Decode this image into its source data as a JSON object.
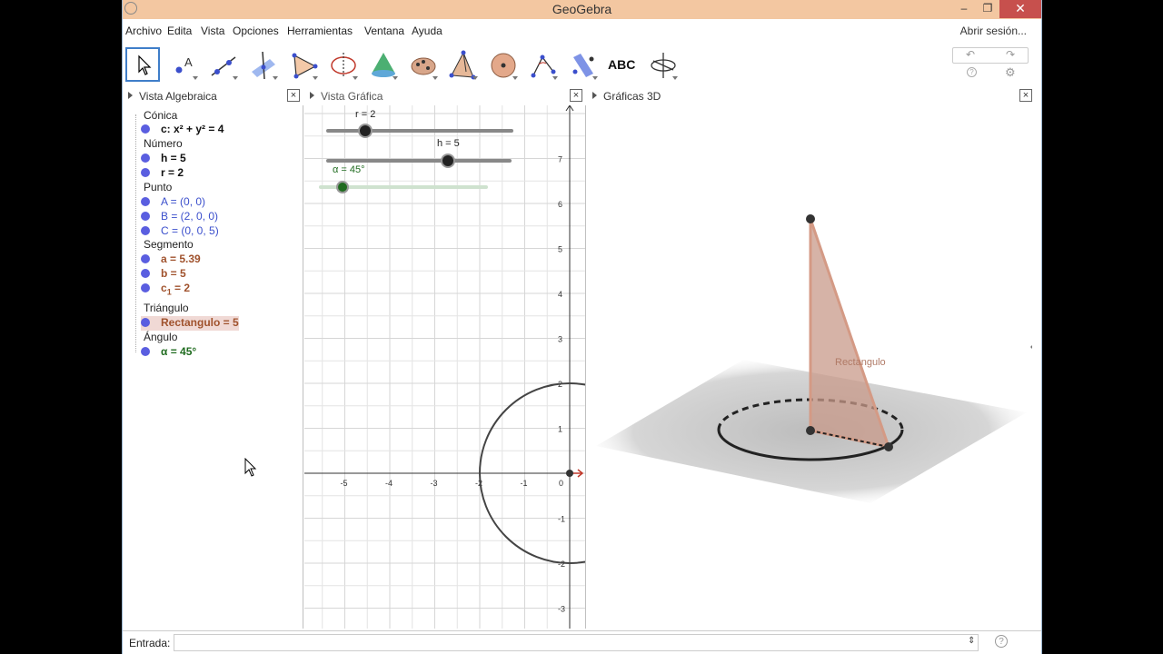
{
  "window": {
    "title": "GeoGebra",
    "minimize": "–",
    "maximize": "❐",
    "close": "✕"
  },
  "menu": {
    "items": [
      "Archivo",
      "Edita",
      "Vista",
      "Opciones",
      "Herramientas",
      "Ventana",
      "Ayuda"
    ],
    "signin": "Abrir sesión..."
  },
  "toolbar": {
    "tools": [
      "move-tool",
      "point-tool",
      "line-tool",
      "perpendicular-tool",
      "polygon-tool",
      "circle-tool",
      "cone-tool",
      "conic-tool",
      "pyramid-tool",
      "sphere-tool",
      "angle-tool",
      "reflect-tool",
      "text-tool",
      "rotate-view-tool"
    ],
    "text_tool_label": "ABC",
    "undo": "↶",
    "redo": "↷",
    "help": "?",
    "settings": "⚙"
  },
  "panels": {
    "algebra": "Vista Algebraica",
    "graphics": "Vista Gráfica",
    "graphics3d": "Gráficas 3D"
  },
  "algebra": {
    "conica": "Cónica",
    "conica_c": "c: x² + y² = 4",
    "numero": "Número",
    "num_h": "h = 5",
    "num_r": "r = 2",
    "punto": "Punto",
    "pt_A": "A = (0, 0)",
    "pt_B": "B = (2, 0, 0)",
    "pt_C": "C = (0, 0, 5)",
    "segmento": "Segmento",
    "seg_a": "a = 5.39",
    "seg_b": "b = 5",
    "seg_c1_name": "c",
    "seg_c1_sub": "1",
    "seg_c1_val": " = 2",
    "triangulo": "Triángulo",
    "tri": "Rectangulo = 5",
    "angulo": "Ángulo",
    "ang": "α = 45°"
  },
  "graphics": {
    "slider_r": "r = 2",
    "slider_h": "h = 5",
    "slider_alpha": "α = 45°",
    "x_ticks": [
      "-5",
      "-4",
      "-3",
      "-2",
      "-1",
      "0"
    ],
    "y_ticks": [
      "7",
      "6",
      "5",
      "4",
      "3",
      "2",
      "1",
      "-1",
      "-2",
      "-3"
    ]
  },
  "view3d": {
    "label": "Rectangulo"
  },
  "input": {
    "label": "Entrada:",
    "value": "",
    "spinner": "⇕",
    "help": "?"
  },
  "colors": {
    "titlebar": "#f3c7a1",
    "point_blue": "#5a5ee0",
    "segment_brown": "#a0522d",
    "angle_green": "#1f6b1f",
    "triangle_fill": "#c89a8a"
  }
}
